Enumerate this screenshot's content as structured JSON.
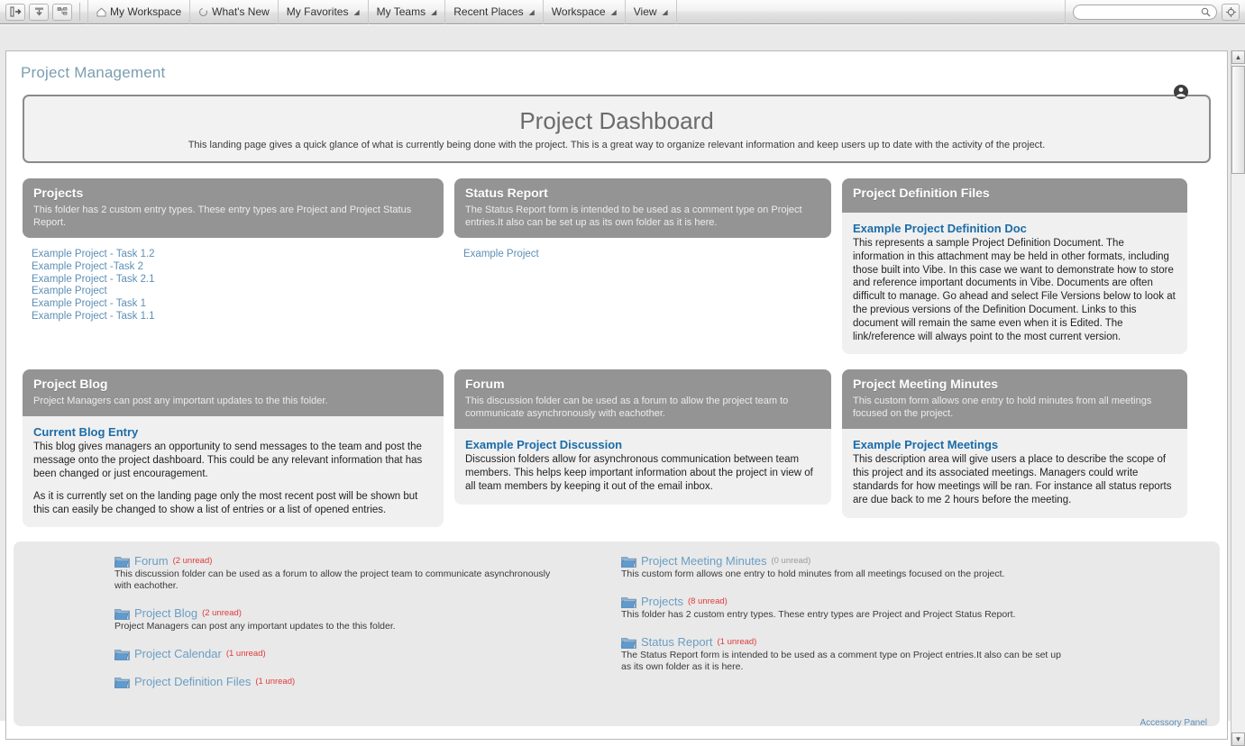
{
  "toolbar": {
    "buttons": [
      {
        "name": "login-arrow-icon",
        "title": "Sign In"
      },
      {
        "name": "download-icon",
        "title": "Download"
      },
      {
        "name": "sitemap-icon",
        "title": "Site Map"
      }
    ],
    "items": [
      {
        "label": "My Workspace",
        "icon": "home-icon",
        "caret": false
      },
      {
        "label": "What's New",
        "icon": "refresh-icon",
        "caret": false
      },
      {
        "label": "My Favorites",
        "icon": "",
        "caret": true
      },
      {
        "label": "My Teams",
        "icon": "",
        "caret": true
      },
      {
        "label": "Recent Places",
        "icon": "",
        "caret": true
      },
      {
        "label": "Workspace",
        "icon": "",
        "caret": true
      },
      {
        "label": "View",
        "icon": "",
        "caret": true
      }
    ],
    "search": {
      "value": "",
      "placeholder": ""
    },
    "help_label": "?"
  },
  "page": {
    "title": "Project Management",
    "accessory_panel_label": "Accessory Panel"
  },
  "banner": {
    "title": "Project Dashboard",
    "subtitle": "This landing page gives a quick glance of what is currently being done with the project. This is a great way to organize relevant information and keep users up to date with the activity of the project."
  },
  "panels": {
    "projects": {
      "title": "Projects",
      "description": "This folder has 2 custom entry types. These entry types are Project and Project Status Report.",
      "links": [
        "Example Project - Task 1.2",
        "Example Project -Task 2",
        "Example Project - Task 2.1",
        "Example Project",
        "Example Project - Task 1",
        "Example Project - Task 1.1"
      ]
    },
    "status_report": {
      "title": "Status Report",
      "description": "The Status Report form is intended to be used as a comment type on Project entries.It also can be set up as its own folder as it is here.",
      "links": [
        "Example Project"
      ]
    },
    "definition_files": {
      "title": "Project Definition Files",
      "description": "",
      "entry_title": "Example Project Definition Doc",
      "entry_body": "This represents a sample Project Definition Document. The information in this attachment may be held in other formats, including those built into Vibe. In this case we want to demonstrate how to store and reference important documents in Vibe. Documents are often difficult to manage. Go ahead and select File Versions below to look at the previous versions of the Definition Document. Links to this document will remain the same even when it is Edited. The link/reference will always point to the most current version."
    },
    "project_blog": {
      "title": "Project Blog",
      "description": "Project Managers can post any important updates to the this folder.",
      "entry_title": "Current Blog Entry",
      "entry_body_1": "This blog gives managers an opportunity to send messages to the team and post the message onto the project dashboard. This could be any relevant information that has been changed or just encouragement.",
      "entry_body_2": "As it is currently set on the landing page only the most recent post will be shown but this can easily be changed to show a list of entries or a list of opened entries."
    },
    "forum": {
      "title": "Forum",
      "description": "This  discussion folder can be used as a forum to allow the project team to communicate asynchronously with eachother.",
      "entry_title": "Example Project Discussion",
      "entry_body": "Discussion folders allow for asynchronous communication between team members. This helps keep important information about the project in view of all team members by keeping it out of the email inbox."
    },
    "meeting_minutes": {
      "title": "Project Meeting Minutes",
      "description": "This custom form allows one entry to hold minutes from all meetings focused on the project.",
      "entry_title": "Example Project Meetings",
      "entry_body": "This description area will give users a place to describe the scope of this project and its associated meetings. Managers could write standards for how meetings will be ran. For instance all status reports are due back to me 2 hours before the meeting."
    }
  },
  "folders": {
    "left": [
      {
        "name": "Forum",
        "unread": "(2 unread)",
        "unread_zero": false,
        "description": "This  discussion folder can be used as a forum to allow the project team to communicate asynchronously with eachother."
      },
      {
        "name": "Project Blog",
        "unread": "(2 unread)",
        "unread_zero": false,
        "description": "Project Managers can post any important updates to the this folder."
      },
      {
        "name": "Project Calendar",
        "unread": "(1 unread)",
        "unread_zero": false,
        "description": ""
      },
      {
        "name": "Project Definition Files",
        "unread": "(1 unread)",
        "unread_zero": false,
        "description": ""
      }
    ],
    "right": [
      {
        "name": "Project Meeting Minutes",
        "unread": "(0 unread)",
        "unread_zero": true,
        "description": "This custom form allows one entry to hold minutes from all meetings focused on the project."
      },
      {
        "name": "Projects",
        "unread": "(8 unread)",
        "unread_zero": false,
        "description": "This folder has 2 custom entry types. These entry types are Project and Project Status Report."
      },
      {
        "name": "Status Report",
        "unread": "(1 unread)",
        "unread_zero": false,
        "description": "The Status Report form is intended to be used as a comment type on Project entries.It also can be set up as its own folder as it is here."
      }
    ]
  },
  "colors": {
    "page_title": "#7b9eb0",
    "panel_header_bg": "#949494",
    "link": "#5d8fb5",
    "entry_title": "#1b6ca8",
    "unread": "#e03a3a",
    "unread_zero": "#9a9a9a",
    "panel_body_tint": "#f0f0f0",
    "folders_panel_bg": "#e9e9e9"
  }
}
